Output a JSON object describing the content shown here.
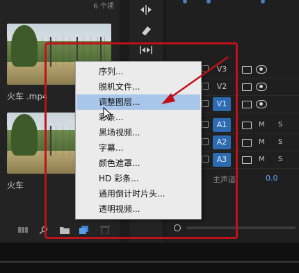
{
  "project_panel": {
    "item_count": "6 个项",
    "clips": [
      {
        "label": "火车 .mp4"
      },
      {
        "label": "火车"
      }
    ],
    "toolbar_icons": [
      "list-view-icon",
      "search-icon",
      "new-bin-icon",
      "new-item-icon",
      "trash-icon"
    ]
  },
  "tools": [
    "ripple-edit-icon",
    "razor-icon",
    "slip-icon"
  ],
  "timeline": {
    "video_tracks": [
      {
        "label": "V3",
        "active": false
      },
      {
        "label": "V2",
        "active": false
      },
      {
        "label": "V1",
        "active": true
      }
    ],
    "audio_tracks": [
      {
        "label": "A1",
        "m": "M",
        "s": "S"
      },
      {
        "label": "A2",
        "m": "M",
        "s": "S"
      },
      {
        "label": "A3",
        "m": "M",
        "s": "S"
      }
    ],
    "master_label": "主声道",
    "master_value": "0.0"
  },
  "context_menu": {
    "items": [
      "序列...",
      "脱机文件...",
      "调整图层...",
      "彩条...",
      "黑场视频...",
      "字幕...",
      "颜色遮罩...",
      "HD 彩条...",
      "通用倒计时片头...",
      "透明视频..."
    ],
    "highlighted_index": 2
  },
  "colors": {
    "annotation_red": "#c0111a",
    "track_active_blue": "#2d6bb0",
    "menu_highlight": "#a7c6ea"
  }
}
